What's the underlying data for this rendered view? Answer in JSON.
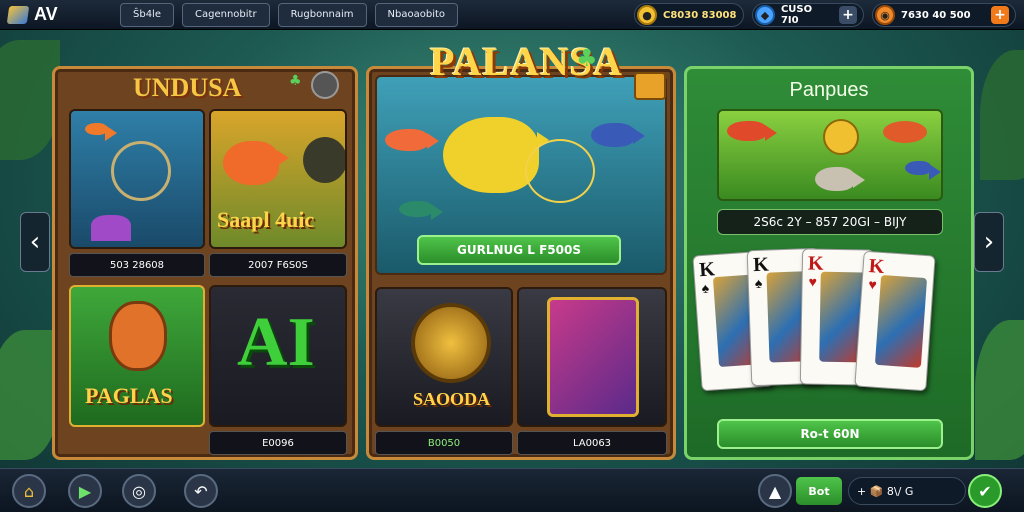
{
  "header": {
    "logo_text": "AV",
    "tabs": [
      {
        "label": "Ŝb4le"
      },
      {
        "label": "Cagennobitr"
      },
      {
        "label": "Rugbonnaim"
      },
      {
        "label": "Nbaoaobito"
      }
    ],
    "currencies": [
      {
        "value": "C8030 83008",
        "icon": "gold-coin-icon",
        "color": "#f3c233",
        "has_plus": false
      },
      {
        "value": "CUSO  7I0",
        "icon": "blue-gem-icon",
        "color": "#4aa3ff",
        "has_plus": true
      },
      {
        "value": "7630   40 500",
        "icon": "orange-token-icon",
        "color": "#f08a2a",
        "has_plus": true
      }
    ]
  },
  "left_panel": {
    "title": "UNDUSA",
    "tiles": [
      {
        "label": "503   28608",
        "art": "underwater-crossbow"
      },
      {
        "label": "2007  F6S0S",
        "art_text": "Saapl 4uic"
      },
      {
        "label": "",
        "art_text": "PAGLAS"
      },
      {
        "label": "E0096",
        "art_text": "AI"
      }
    ]
  },
  "mid_panel": {
    "title": "PALANSA",
    "button_label": "GURLNUG L  F500S",
    "tiles": [
      {
        "label": "B0050",
        "art_text": "SAOODA"
      },
      {
        "label": "LA0063",
        "art": "pink-card"
      }
    ]
  },
  "right_panel": {
    "title": "Panpues",
    "info_bar": "2S6c 2Y – 857 20GI – BIJY",
    "button_label": "Ro-t 60N",
    "cards": [
      {
        "rank": "K",
        "suit": "♠",
        "color": "#111"
      },
      {
        "rank": "K",
        "suit": "♠",
        "color": "#111"
      },
      {
        "rank": "K",
        "suit": "♥",
        "color": "#c01818"
      },
      {
        "rank": "K",
        "suit": "♥",
        "color": "#c01818"
      }
    ]
  },
  "bottom": {
    "bet_label": "Bot",
    "bet_value": "+   📦  8\\/  G",
    "icons": [
      "home-icon",
      "play-icon",
      "target-icon",
      "back-icon",
      "rocket-icon",
      "confirm-icon"
    ]
  }
}
